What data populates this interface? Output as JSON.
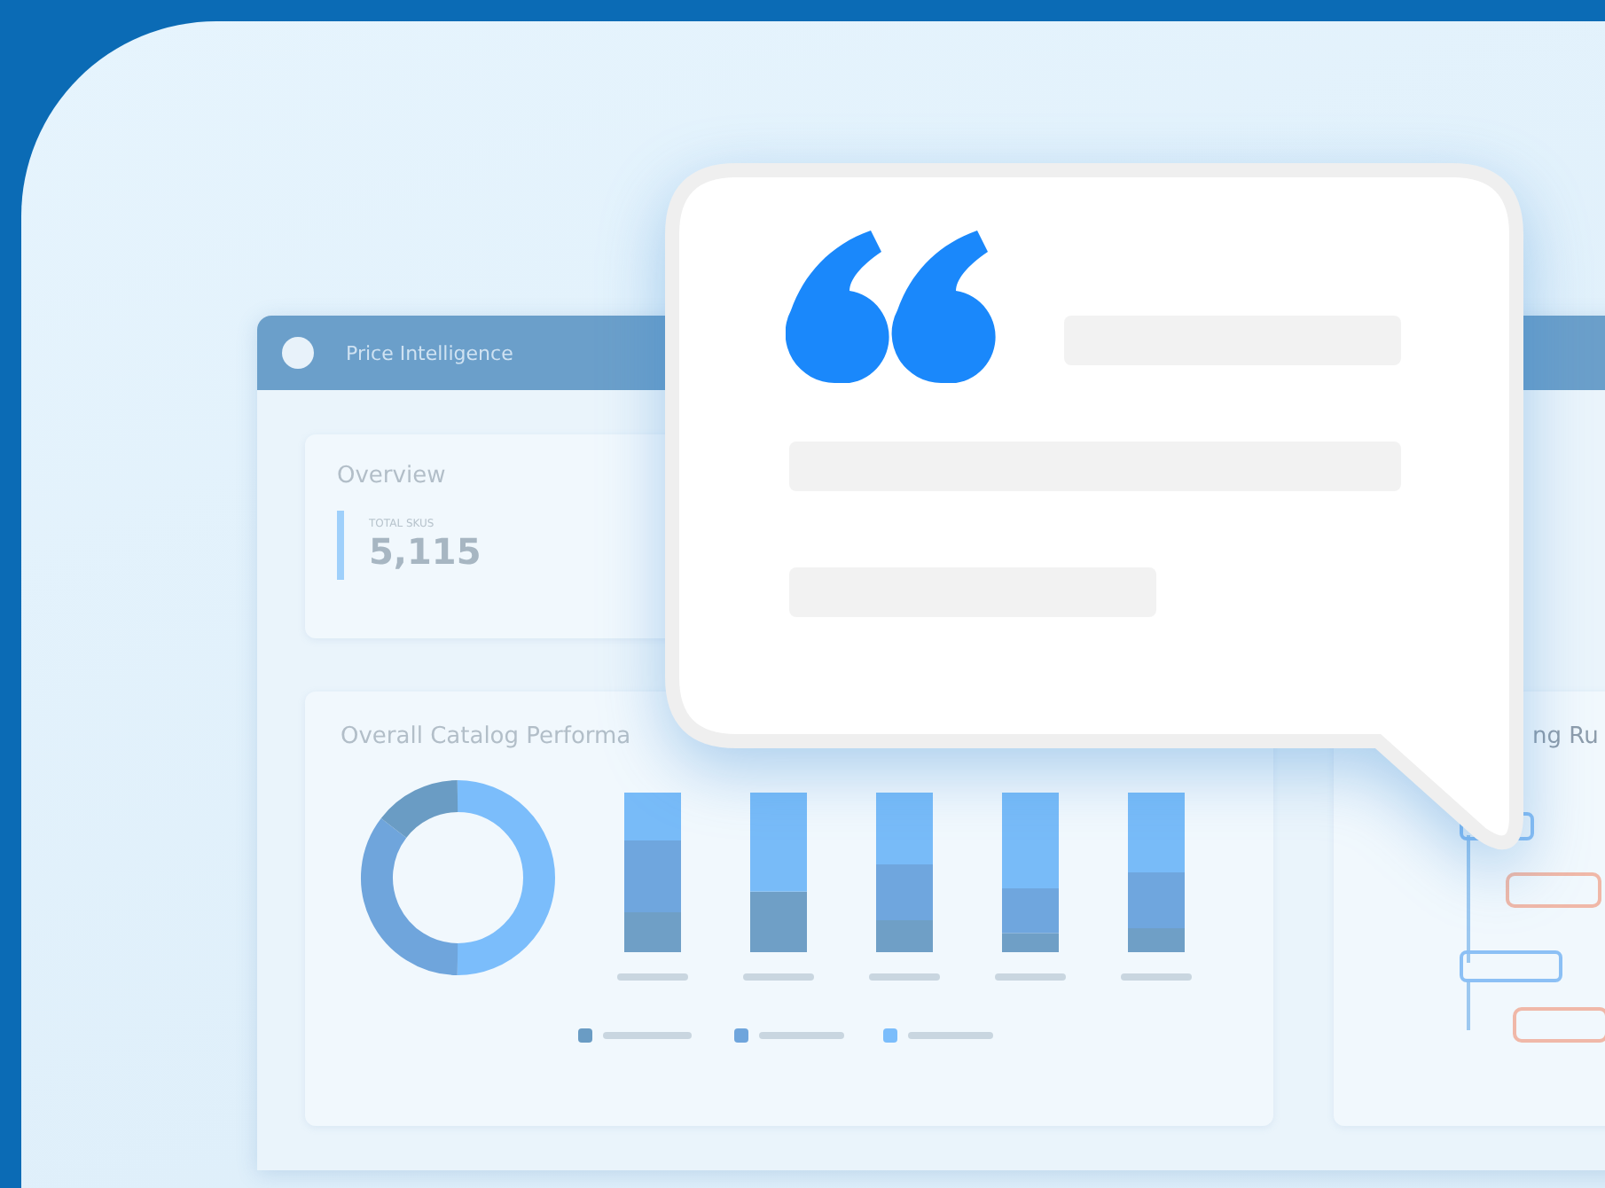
{
  "dashboard": {
    "title": "Price Intelligence",
    "overview": {
      "heading": "Overview",
      "stat_label": "TOTAL SKUS",
      "stat_value": "5,115"
    },
    "catalog_card": {
      "heading": "Overall Catalog Performa"
    },
    "side_card": {
      "heading": "ng Ru"
    }
  }
}
